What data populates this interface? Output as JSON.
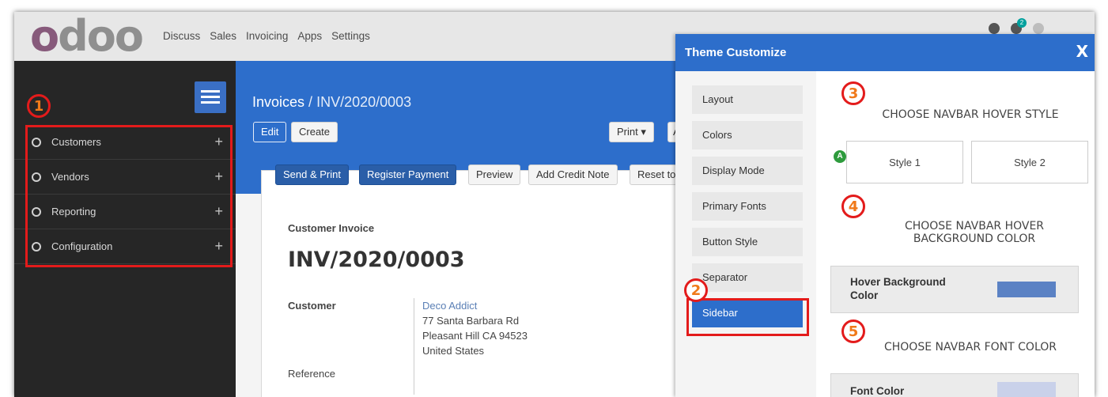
{
  "navbar": {
    "logo": "odoo",
    "menu": [
      "Discuss",
      "Sales",
      "Invoicing",
      "Apps",
      "Settings"
    ],
    "badge_count": "2"
  },
  "sidebar": {
    "items": [
      {
        "label": "Customers"
      },
      {
        "label": "Vendors"
      },
      {
        "label": "Reporting"
      },
      {
        "label": "Configuration"
      }
    ]
  },
  "breadcrumb": {
    "parent": "Invoices",
    "separator": " / ",
    "current": "INV/2020/0003"
  },
  "toolbar": {
    "edit": "Edit",
    "create": "Create",
    "print": "Print ▾",
    "action_partial": "A"
  },
  "statusbar": {
    "send_print": "Send & Print",
    "register_payment": "Register Payment",
    "preview": "Preview",
    "add_credit_note": "Add Credit Note",
    "reset": "Reset to"
  },
  "invoice": {
    "type_label": "Customer Invoice",
    "number": "INV/2020/0003",
    "customer_label": "Customer",
    "customer_name": "Deco Addict",
    "address_line1": "77 Santa Barbara Rd",
    "address_line2": "Pleasant Hill CA 94523",
    "address_line3": "United States",
    "reference_label": "Reference"
  },
  "theme_panel": {
    "title": "Theme Customize",
    "close": "X",
    "nav": [
      "Layout",
      "Colors",
      "Display Mode",
      "Primary Fonts",
      "Button Style",
      "Separator",
      "Sidebar"
    ],
    "active_nav": "Sidebar",
    "section_hover_style": "CHOOSE NAVBAR HOVER STYLE",
    "style_1": "Style 1",
    "style_2": "Style 2",
    "selected_marker": "A",
    "section_hover_bg_line1": "CHOOSE NAVBAR HOVER",
    "section_hover_bg_line2": "BACKGROUND COLOR",
    "hover_bg_label_line1": "Hover Background",
    "hover_bg_label_line2": "Color",
    "hover_bg_color": "#5b82c4",
    "section_font_color": "CHOOSE NAVBAR FONT COLOR",
    "font_color_label": "Font Color",
    "font_color": "#c9d1ea"
  },
  "callouts": [
    "1",
    "2",
    "3",
    "4",
    "5"
  ],
  "colors": {
    "brand": "#875a7b",
    "primary": "#2d6ecb",
    "highlight": "#e31b1b",
    "callout_number": "#f07a1a"
  }
}
